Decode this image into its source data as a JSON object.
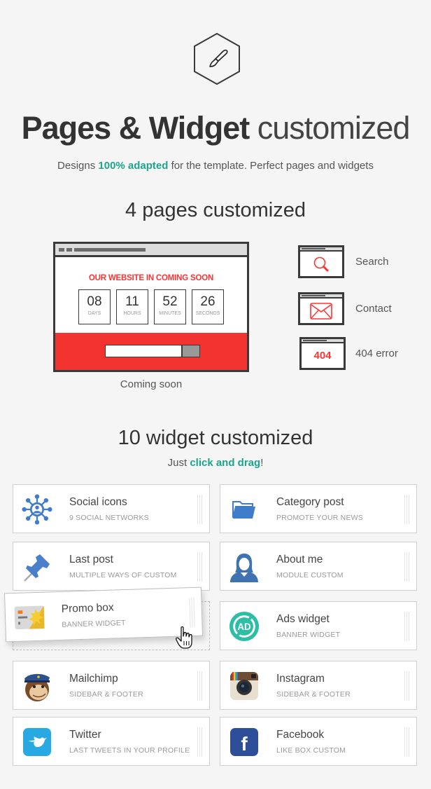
{
  "header": {
    "icon": "paintbrush-icon",
    "title_bold": "Pages & Widget",
    "title_light": "customized",
    "subtitle_prefix": "Designs ",
    "subtitle_accent": "100% adapted",
    "subtitle_suffix": " for the template. Perfect pages and widgets"
  },
  "pages_section": {
    "heading": "4 pages customized",
    "coming_soon": {
      "headline": "OUR WEBSITE IN COMING SOON",
      "countdown": [
        {
          "value": "08",
          "label": "DAYS"
        },
        {
          "value": "11",
          "label": "HOURS"
        },
        {
          "value": "52",
          "label": "MINUTES"
        },
        {
          "value": "26",
          "label": "SECONDS"
        }
      ],
      "caption": "Coming soon"
    },
    "mini_pages": [
      {
        "label": "Search",
        "icon": "search-icon"
      },
      {
        "label": "Contact",
        "icon": "envelope-icon"
      },
      {
        "label": "404 error",
        "icon_text": "404"
      }
    ]
  },
  "widgets_section": {
    "heading": "10 widget customized",
    "hint_prefix": "Just ",
    "hint_accent": "click and drag",
    "hint_suffix": "!",
    "widgets": [
      {
        "name": "Social icons",
        "desc": "9 SOCIAL NETWORKS",
        "icon": "social-network-icon"
      },
      {
        "name": "Category post",
        "desc": "PROMOTE YOUR NEWS",
        "icon": "folder-icon"
      },
      {
        "name": "Last post",
        "desc": "MULTIPLE WAYS OF CUSTOM",
        "icon": "pushpin-icon"
      },
      {
        "name": "About me",
        "desc": "MODULE CUSTOM",
        "icon": "user-female-icon"
      },
      {
        "name": "Promo box",
        "desc": "BANNER WIDGET",
        "icon": "promo-card-icon"
      },
      {
        "name": "Ads widget",
        "desc": "BANNER WIDGET",
        "icon": "ad-badge-icon"
      },
      {
        "name": "Mailchimp",
        "desc": "SIDEBAR & FOOTER",
        "icon": "mailchimp-icon"
      },
      {
        "name": "Instagram",
        "desc": "SIDEBAR & FOOTER",
        "icon": "instagram-icon"
      },
      {
        "name": "Twitter",
        "desc": "LAST TWEETS IN YOUR PROFILE",
        "icon": "twitter-icon"
      },
      {
        "name": "Facebook",
        "desc": "LIKE BOX CUSTOM",
        "icon": "facebook-icon"
      }
    ]
  },
  "colors": {
    "accent": "#1aa58c",
    "red": "#f33330",
    "icon_blue": "#3f7cc9"
  }
}
